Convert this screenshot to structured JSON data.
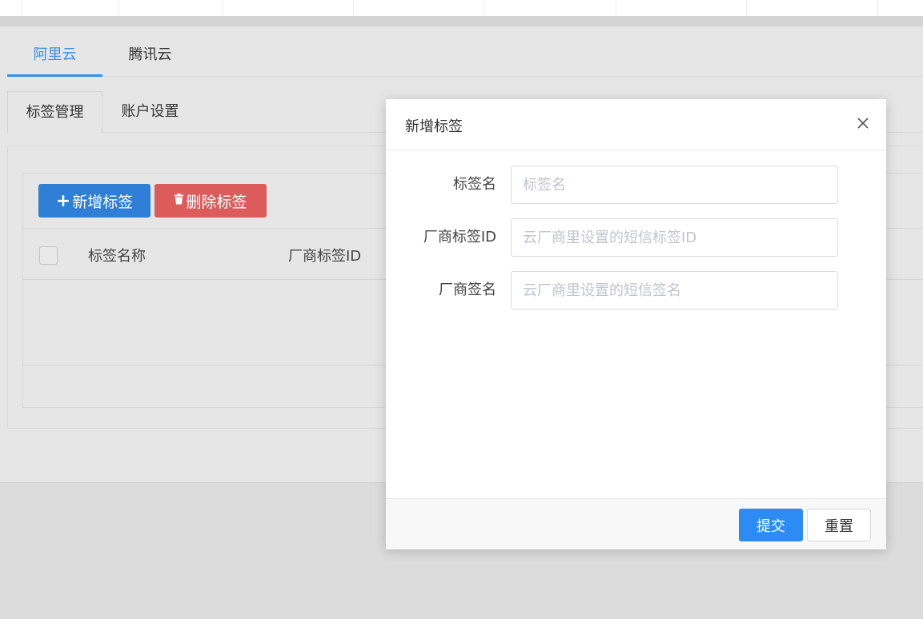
{
  "vendor_tabs": [
    {
      "label": "阿里云",
      "active": true
    },
    {
      "label": "腾讯云",
      "active": false
    }
  ],
  "sub_tabs": [
    {
      "label": "标签管理",
      "active": true
    },
    {
      "label": "账户设置",
      "active": false
    }
  ],
  "toolbar": {
    "add_icon": "plus-icon",
    "add_label": "新增标签",
    "delete_icon": "trash-icon",
    "delete_label": "删除标签"
  },
  "table": {
    "columns": [
      "标签名称",
      "厂商标签ID"
    ],
    "rows": []
  },
  "modal": {
    "title": "新增标签",
    "close_icon": "close-icon",
    "fields": [
      {
        "label": "标签名",
        "placeholder": "标签名",
        "value": ""
      },
      {
        "label": "厂商标签ID",
        "placeholder": "云厂商里设置的短信标签ID",
        "value": ""
      },
      {
        "label": "厂商签名",
        "placeholder": "云厂商里设置的短信签名",
        "value": ""
      }
    ],
    "submit_label": "提交",
    "reset_label": "重置"
  },
  "colors": {
    "primary": "#2c8cf4",
    "danger": "#dc5c5c",
    "active_tab": "#3a8ee6"
  }
}
